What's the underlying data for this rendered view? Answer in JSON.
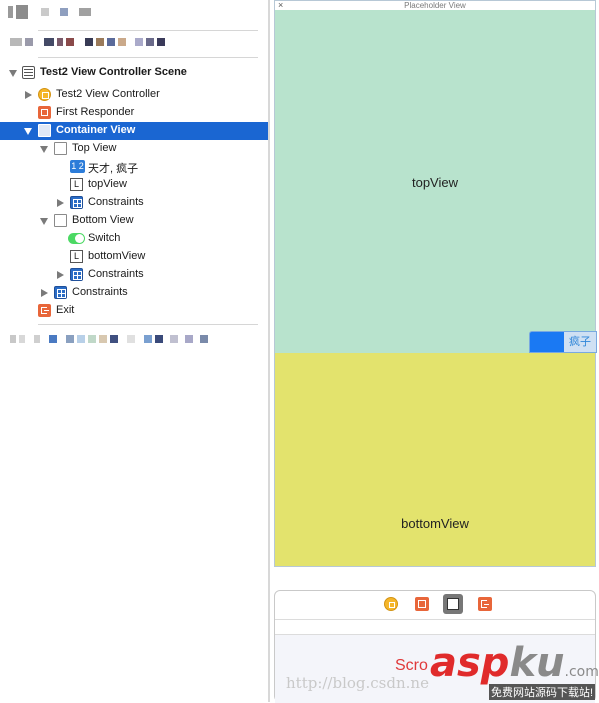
{
  "outline": {
    "scene_title": "Test2 View Controller Scene",
    "rows": [
      {
        "label": "Test2 View Controller",
        "icon": "view-controller-icon"
      },
      {
        "label": "First Responder",
        "icon": "first-responder-icon"
      },
      {
        "label": "Container View",
        "icon": "view-icon",
        "selected": true
      },
      {
        "label": "Top View",
        "icon": "view-icon"
      },
      {
        "label": "天才, 疯子",
        "icon": "segmented-control-icon",
        "icon_text": "1 2"
      },
      {
        "label": "topView",
        "icon": "label-icon",
        "icon_text": "L"
      },
      {
        "label": "Constraints",
        "icon": "constraints-icon"
      },
      {
        "label": "Bottom View",
        "icon": "view-icon"
      },
      {
        "label": "Switch",
        "icon": "switch-icon"
      },
      {
        "label": "bottomView",
        "icon": "label-icon",
        "icon_text": "L"
      },
      {
        "label": "Constraints",
        "icon": "constraints-icon"
      },
      {
        "label": "Constraints",
        "icon": "constraints-icon"
      },
      {
        "label": "Exit",
        "icon": "exit-icon"
      }
    ]
  },
  "canvas": {
    "placeholder_title": "Placeholder View",
    "close_glyph": "×",
    "top_label": "topView",
    "bottom_label": "bottomView",
    "segment_label": "疯子",
    "dock_text": "Scro"
  },
  "watermark": {
    "url": "http://blog.csdn.ne",
    "brand_asp": "asp",
    "brand_ku": "ku",
    "brand_com": ".com",
    "tagline": "免费网站源码下载站!"
  },
  "colors": {
    "selection": "#1a66d2",
    "top_view": "#b8e3cd",
    "bottom_view": "#e3e36d",
    "switch_on": "#1a79f3",
    "accent_red": "#e0393a"
  }
}
